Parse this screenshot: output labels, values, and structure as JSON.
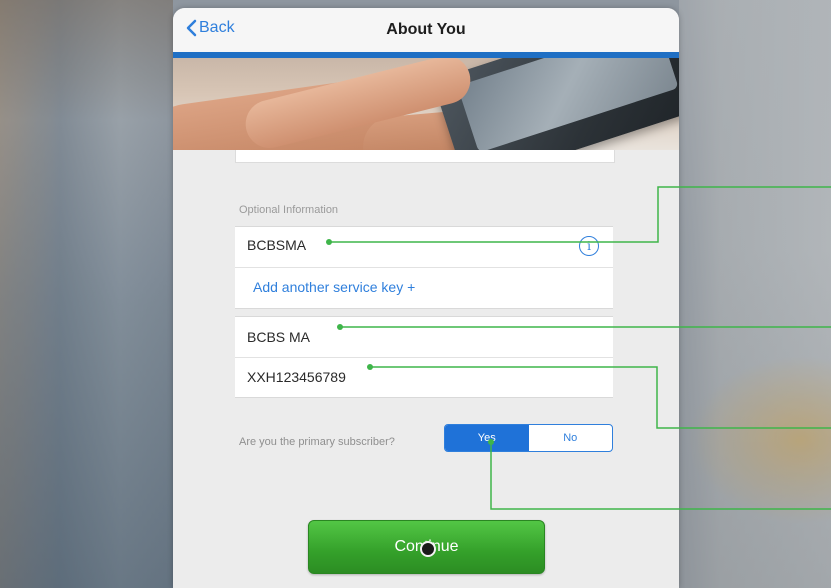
{
  "nav": {
    "back_label": "Back",
    "title": "About You"
  },
  "optional": {
    "section_label": "Optional Information",
    "service_key_value": "BCBSMA",
    "add_service_key_label": "Add another service key +",
    "plan_name_value": "BCBS MA",
    "member_id_value": "XXH123456789"
  },
  "primary": {
    "question": "Are you the primary subscriber?",
    "yes_label": "Yes",
    "no_label": "No",
    "selected": "Yes"
  },
  "continue_label": "Continue",
  "colors": {
    "accent_blue": "#2f7fdc",
    "continue_green": "#3cad30",
    "callout_green": "#3fb54a"
  },
  "icons": {
    "back": "chevron-left-icon",
    "info": "info-icon"
  }
}
